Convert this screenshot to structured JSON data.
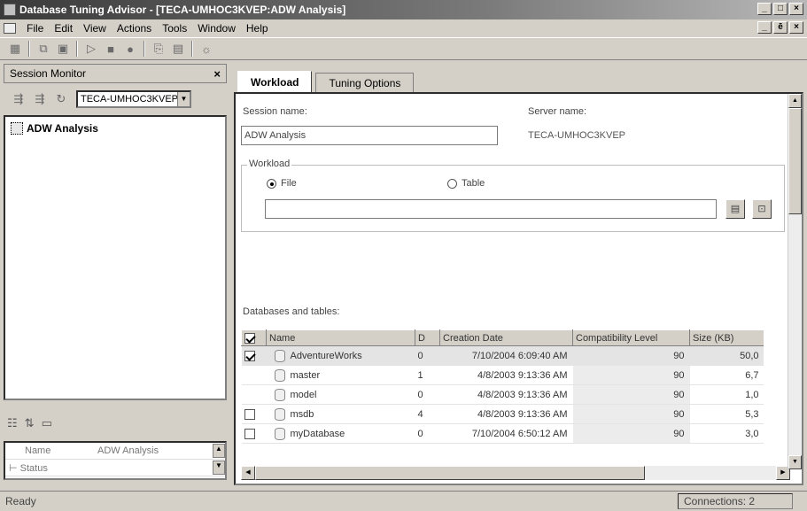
{
  "window": {
    "title": "Database Tuning Advisor - [TECA-UMHOC3KVEP:ADW Analysis]",
    "min_label": "_",
    "max_label": "□",
    "close_label": "×",
    "mdi_min_label": "_",
    "mdi_restore_label": "ē",
    "mdi_close_label": "×"
  },
  "menu": [
    "File",
    "Edit",
    "View",
    "Actions",
    "Tools",
    "Window",
    "Help"
  ],
  "session_monitor": {
    "title": "Session Monitor",
    "close_label": "×",
    "server_select": "TECA-UMHOC3KVEP",
    "sessions": [
      "ADW Analysis"
    ],
    "properties": [
      {
        "name": "Name",
        "value": "ADW Analysis"
      },
      {
        "name": "Status",
        "value": ""
      }
    ],
    "expand_label": "⊢"
  },
  "tabs": [
    "Workload",
    "Tuning Options"
  ],
  "workload": {
    "session_name_label": "Session name:",
    "session_name_value": "ADW Analysis",
    "server_name_label": "Server name:",
    "server_name_value": "TECA-UMHOC3KVEP",
    "group_label": "Workload",
    "file_label": "File",
    "table_label": "Table",
    "file_selected": true,
    "file_path": ""
  },
  "databases": {
    "label": "Databases and tables:",
    "columns": [
      "Name",
      "D",
      "Creation Date",
      "Compatibility Level",
      "Size (KB)"
    ],
    "rows": [
      {
        "checked": true,
        "name": "AdventureWorks",
        "d": "0",
        "date": "7/10/2004 6:09:40 AM",
        "compat": "90",
        "size": "50,0"
      },
      {
        "checked": null,
        "name": "master",
        "d": "1",
        "date": "4/8/2003 9:13:36 AM",
        "compat": "90",
        "size": "6,7"
      },
      {
        "checked": null,
        "name": "model",
        "d": "0",
        "date": "4/8/2003 9:13:36 AM",
        "compat": "90",
        "size": "1,0"
      },
      {
        "checked": false,
        "name": "msdb",
        "d": "4",
        "date": "4/8/2003 9:13:36 AM",
        "compat": "90",
        "size": "5,3"
      },
      {
        "checked": false,
        "name": "myDatabase",
        "d": "0",
        "date": "7/10/2004 6:50:12 AM",
        "compat": "90",
        "size": "3,0"
      }
    ]
  },
  "status": {
    "left": "Ready",
    "right": "Connections: 2"
  }
}
